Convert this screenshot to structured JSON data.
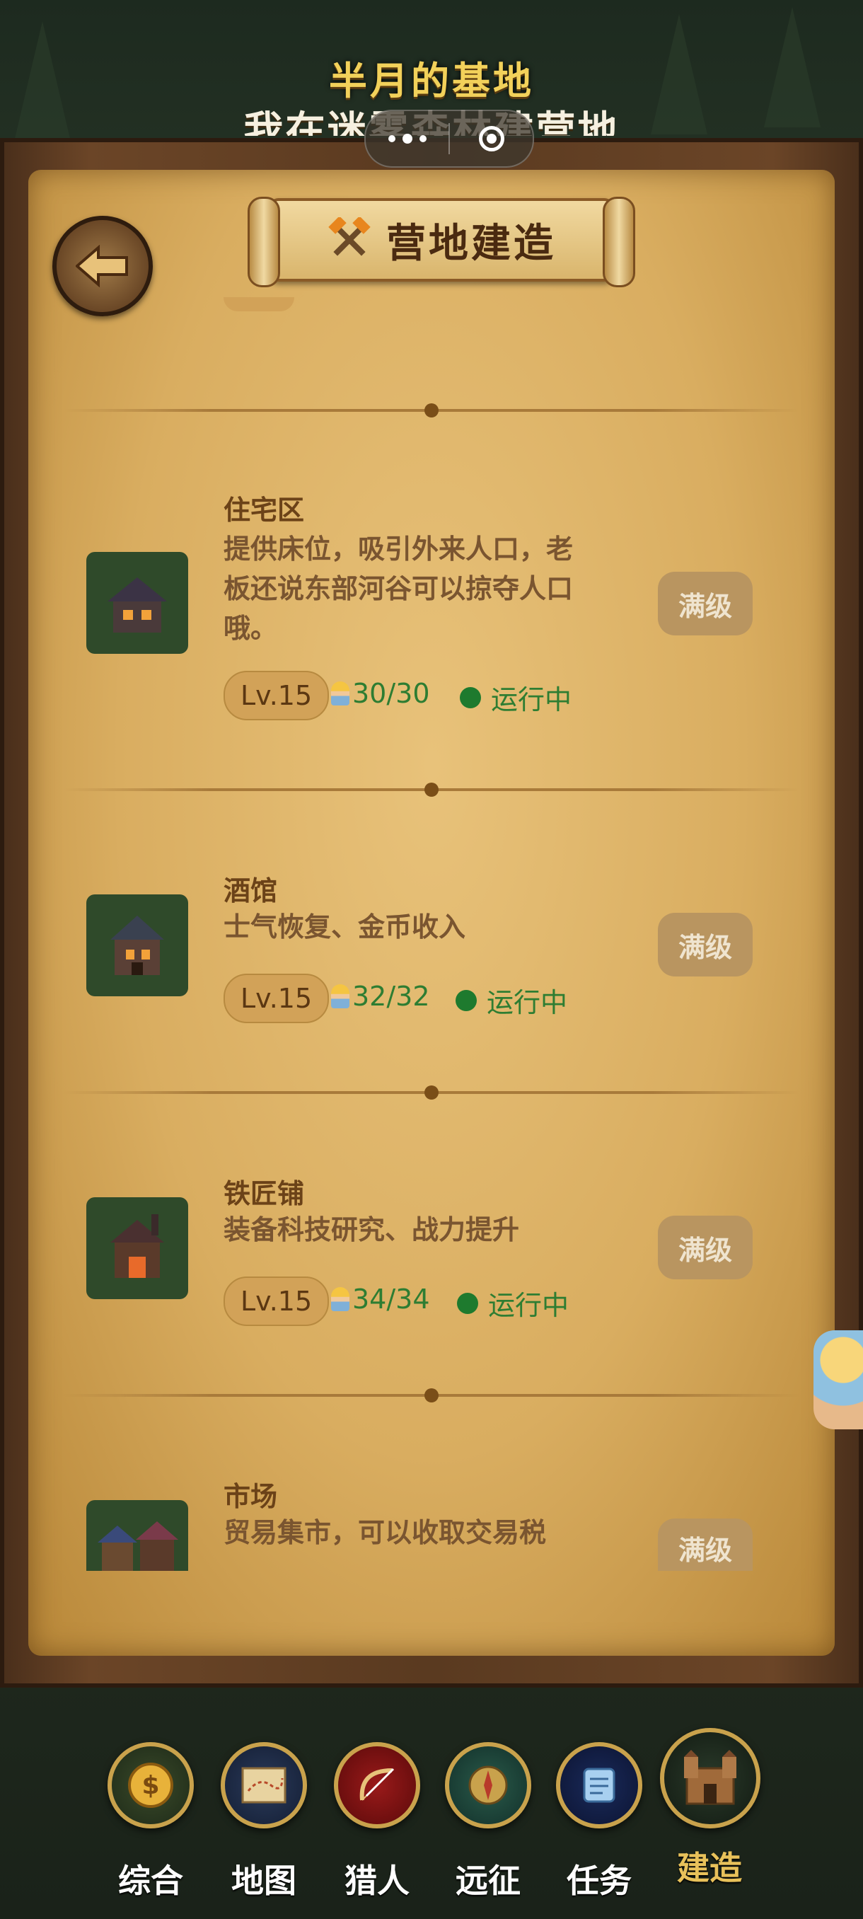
{
  "header": {
    "title_main": "半月的基地",
    "title_sub": "我在迷雾森林建营地"
  },
  "panel": {
    "title": "营地建造",
    "back_icon": "back-arrow-icon"
  },
  "buildings": [
    {
      "name": "住宅区",
      "desc": "提供床位，吸引外来人口，老板还说东部河谷可以掠夺人口哦。",
      "level": "Lv.15",
      "workers": "30/30",
      "status": "运行中",
      "button": "满级"
    },
    {
      "name": "酒馆",
      "desc": "士气恢复、金币收入",
      "level": "Lv.15",
      "workers": "32/32",
      "status": "运行中",
      "button": "满级"
    },
    {
      "name": "铁匠铺",
      "desc": "装备科技研究、战力提升",
      "level": "Lv.15",
      "workers": "34/34",
      "status": "运行中",
      "button": "满级"
    },
    {
      "name": "市场",
      "desc": "贸易集市，可以收取交易税",
      "button": "满级"
    }
  ],
  "nav": [
    {
      "label": "综合",
      "icon": "coin-icon"
    },
    {
      "label": "地图",
      "icon": "map-icon"
    },
    {
      "label": "猎人",
      "icon": "bow-icon"
    },
    {
      "label": "远征",
      "icon": "compass-icon"
    },
    {
      "label": "任务",
      "icon": "scroll-icon"
    },
    {
      "label": "建造",
      "icon": "castle-icon",
      "active": true
    }
  ],
  "colors": {
    "accent": "#e8c15a",
    "status_green": "#2e7d32",
    "parchment": "#d9ad60"
  }
}
